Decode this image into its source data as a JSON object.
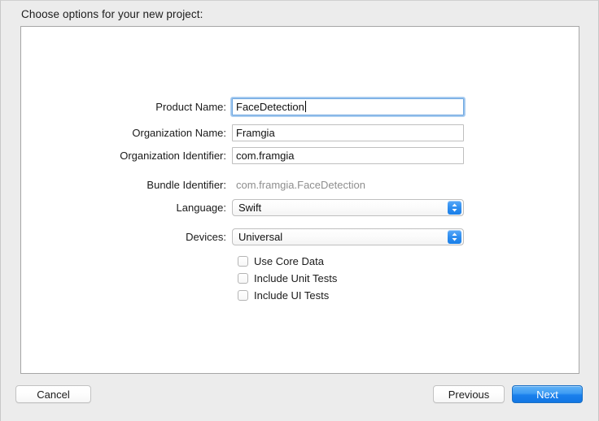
{
  "dialog": {
    "prompt": "Choose options for your new project:"
  },
  "form": {
    "fields": [
      {
        "label": "Product Name:",
        "value": "FaceDetection",
        "type": "textfield",
        "focused": true
      },
      {
        "label": "Organization Name:",
        "value": "Framgia",
        "type": "textfield",
        "focused": false
      },
      {
        "label": "Organization Identifier:",
        "value": "com.framgia",
        "type": "textfield",
        "focused": false
      },
      {
        "label": "Bundle Identifier:",
        "value": "com.framgia.FaceDetection",
        "type": "static"
      },
      {
        "label": "Language:",
        "value": "Swift",
        "type": "popup"
      },
      {
        "label": "Devices:",
        "value": "Universal",
        "type": "popup"
      }
    ]
  },
  "checkboxes": [
    {
      "label": "Use Core Data",
      "checked": false
    },
    {
      "label": "Include Unit Tests",
      "checked": false
    },
    {
      "label": "Include UI Tests",
      "checked": false
    }
  ],
  "footer": {
    "cancel_label": "Cancel",
    "previous_label": "Previous",
    "next_label": "Next"
  },
  "colors": {
    "accent_blue": "#1b80ec",
    "popup_arrow_blue": "#2f8ef0",
    "focus_ring": "#70a8e0",
    "dialog_bg": "#ececec",
    "panel_bg": "#ffffff",
    "static_text": "#8e8e8e"
  }
}
